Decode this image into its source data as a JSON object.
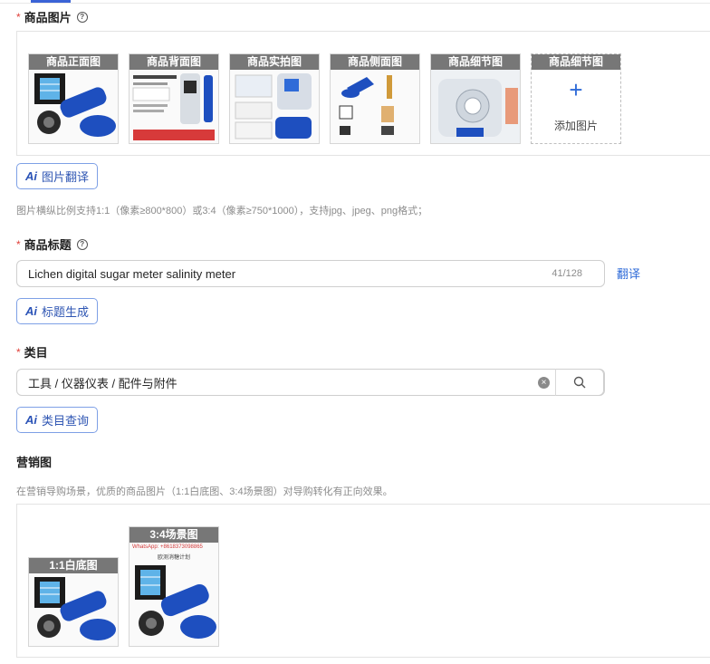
{
  "product_images": {
    "label": "商品图片",
    "tiles": [
      {
        "caption": "商品正面图"
      },
      {
        "caption": "商品背面图"
      },
      {
        "caption": "商品实拍图"
      },
      {
        "caption": "商品侧面图"
      },
      {
        "caption": "商品细节图"
      }
    ],
    "add_tile": {
      "caption": "商品细节图",
      "label": "添加图片"
    },
    "translate_button": "图片翻译",
    "hint": "图片横纵比例支持1:1（像素≥800*800）或3:4（像素≥750*1000），支持jpg、jpeg、png格式；"
  },
  "title_field": {
    "label": "商品标题",
    "value": "Lichen digital sugar meter salinity meter",
    "count": "41/128",
    "translate_link": "翻译",
    "generate_button": "标题生成"
  },
  "category": {
    "label": "类目",
    "value": "工具 / 仪器仪表 / 配件与附件",
    "query_button": "类目查询"
  },
  "marketing": {
    "label": "营销图",
    "hint": "在营销导购场景，优质的商品图片（1:1白底图、3:4场景图）对导购转化有正向效果。",
    "white_bg_caption": "1:1白底图",
    "scene_caption": "3:4场景图",
    "scene_watermark": "WhatsApp: +8618373098865",
    "scene_subtitle": "欧测消糖计划"
  },
  "icons": {
    "ai": "ai-sparkle-icon",
    "help": "help-circle-icon",
    "plus": "plus-icon",
    "clear": "clear-circle-icon",
    "search": "search-icon"
  },
  "colors": {
    "accent": "#2f6bd8",
    "required": "#e0403a",
    "caption_bg": "#646464",
    "product_blue": "#1e4fbf"
  }
}
